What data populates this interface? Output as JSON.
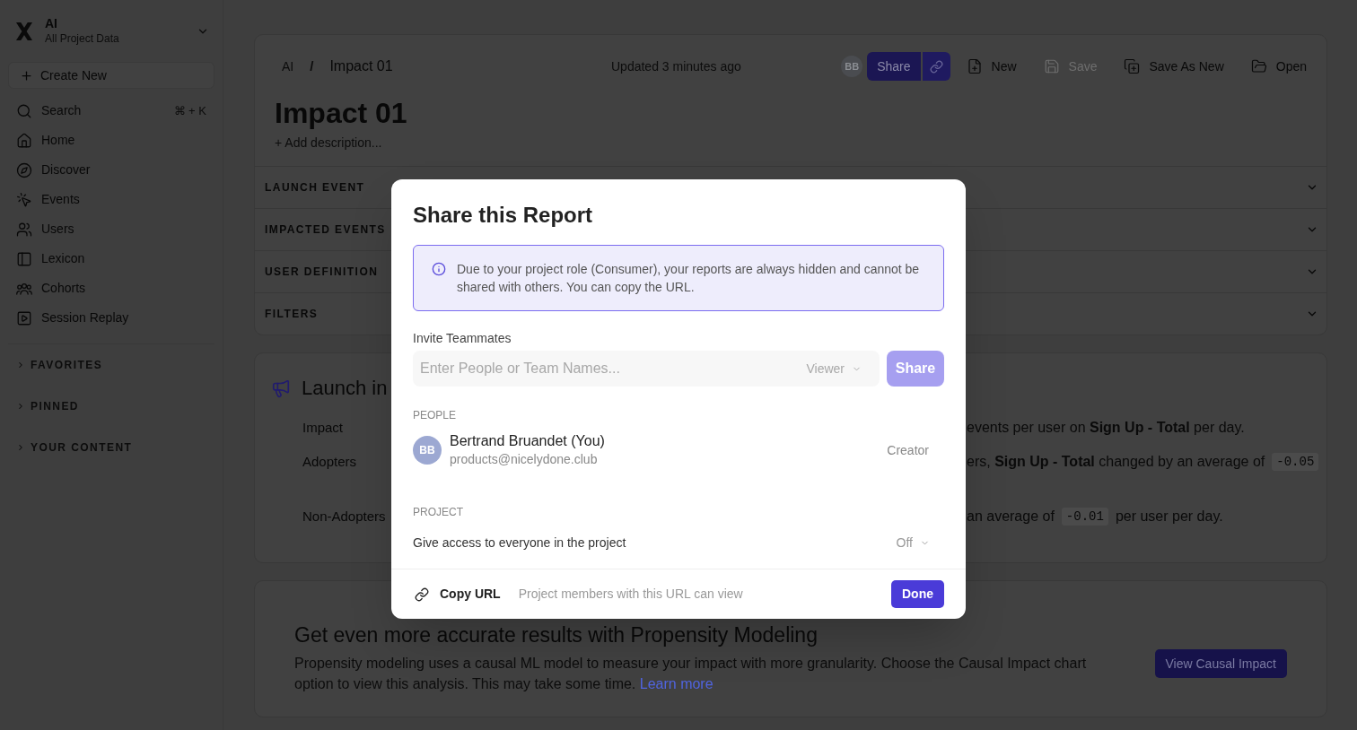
{
  "sidebar": {
    "workspace": {
      "name": "AI",
      "subtitle": "All Project Data"
    },
    "create_button": "Create New",
    "nav": [
      {
        "label": "Search",
        "shortcut": "⌘ + K"
      },
      {
        "label": "Home"
      },
      {
        "label": "Discover"
      },
      {
        "label": "Events"
      },
      {
        "label": "Users"
      },
      {
        "label": "Lexicon"
      },
      {
        "label": "Cohorts"
      },
      {
        "label": "Session Replay"
      }
    ],
    "sections": [
      {
        "label": "FAVORITES",
        "expanded": false
      },
      {
        "label": "PINNED",
        "expanded": false
      },
      {
        "label": "YOUR CONTENT",
        "expanded": false
      }
    ]
  },
  "header": {
    "breadcrumb": [
      "AI",
      "Impact 01"
    ],
    "separator": "/",
    "updated": "Updated 3 minutes ago",
    "avatar": "BB",
    "share_button": "Share",
    "actions": [
      {
        "label": "New",
        "disabled": false
      },
      {
        "label": "Save",
        "disabled": true
      },
      {
        "label": "Save As New",
        "disabled": false
      },
      {
        "label": "Open",
        "disabled": false
      }
    ]
  },
  "report": {
    "title": "Impact 01",
    "add_description": "+ Add description...",
    "sections": [
      {
        "label": "LAUNCH EVENT",
        "expanded": false
      },
      {
        "label": "IMPACTED EVENTS",
        "expanded": false
      },
      {
        "label": "USER DEFINITION",
        "expanded": false
      },
      {
        "label": "FILTERS",
        "expanded": false
      }
    ]
  },
  "insight": {
    "title": "Launch in",
    "rows": [
      {
        "label": "Impact",
        "parts": [
          {
            "kind": "text",
            "text": "events per user on **Sign Up - Total** per day."
          }
        ]
      },
      {
        "label": "Adopters",
        "parts": [
          {
            "kind": "text",
            "text": "ers, **Sign Up - Total** changed by an average of"
          },
          {
            "kind": "code",
            "text": "-0.05"
          }
        ]
      },
      {
        "label": "Non-Adopters",
        "parts": [
          {
            "kind": "text",
            "text": "an average of"
          },
          {
            "kind": "code",
            "text": "-0.01"
          },
          {
            "kind": "text",
            "text": "per user per day."
          }
        ]
      }
    ]
  },
  "propensity": {
    "title": "Get even more accurate results with Propensity Modeling",
    "text": "Propensity modeling uses a causal ML model to measure your impact with more granularity. Choose the Causal Impact chart option to view this analysis. This may take some time.",
    "link": "Learn more",
    "button": "View Causal Impact"
  },
  "modal": {
    "title": "Share this Report",
    "notice": "Due to your project role (Consumer), your reports are always hidden and cannot be shared with others. You can copy the URL.",
    "invite_label": "Invite Teammates",
    "invite_field": {
      "placeholder": "Enter People or Team Names...",
      "role": "Viewer"
    },
    "share_button": {
      "label": "Share",
      "disabled": true
    },
    "people_heading": "PEOPLE",
    "people": [
      {
        "initials": "BB",
        "name": "Bertrand Bruandet (You)",
        "email": "products@nicelydone.club",
        "role": "Creator"
      }
    ],
    "project_heading": "PROJECT",
    "project_access": {
      "label": "Give access to everyone in the project",
      "value": "Off"
    },
    "copy_url": "Copy URL",
    "footer_note": "Project members with this URL can view",
    "done_button": "Done"
  }
}
